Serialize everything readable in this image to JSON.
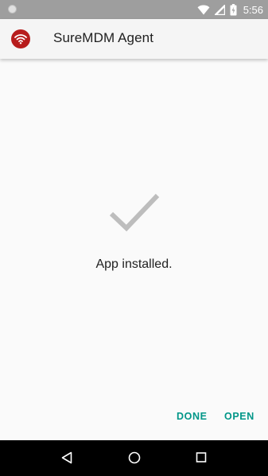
{
  "status_bar": {
    "time": "5:56",
    "icons": [
      "notification-dot-icon",
      "wifi-icon",
      "signal-icon",
      "battery-icon"
    ]
  },
  "app_bar": {
    "title": "SureMDM Agent",
    "icon": "suremdm-logo-icon",
    "icon_color": "#b71c1c"
  },
  "main": {
    "status_icon": "checkmark-icon",
    "message": "App installed.",
    "actions": {
      "done_label": "DONE",
      "open_label": "OPEN"
    },
    "accent_color": "#009688"
  },
  "nav_bar": {
    "buttons": [
      "back-icon",
      "home-icon",
      "recents-icon"
    ]
  }
}
